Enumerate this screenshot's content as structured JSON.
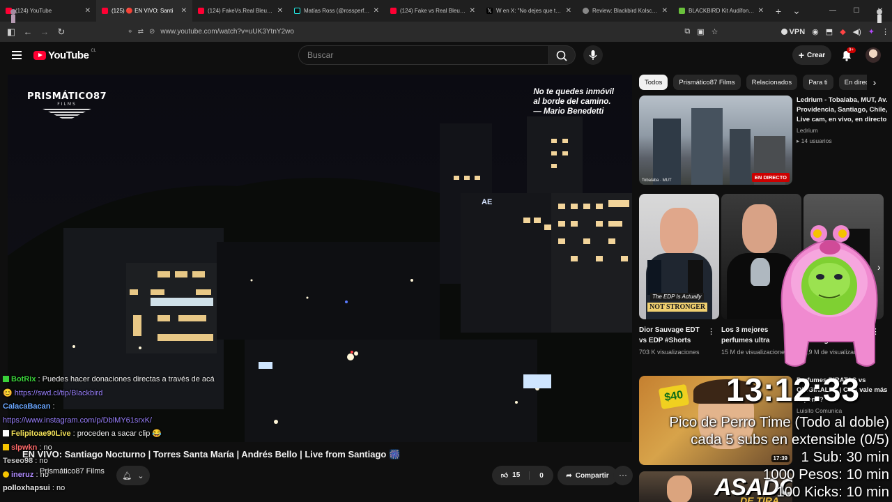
{
  "tabs": [
    {
      "title": "(124) YouTube",
      "favicon": "youtube-icon",
      "active": false
    },
    {
      "title": "(125) 🔴 EN VIVO: Santi",
      "favicon": "youtube-icon",
      "active": true
    },
    {
      "title": "(124) FakeVs.Real Bleu de Ch",
      "favicon": "youtube-icon",
      "active": false
    },
    {
      "title": "Matías Ross (@rossperfume",
      "favicon": "tiktok-icon",
      "active": false
    },
    {
      "title": "(124) Fake vs Real Bleu de Ch",
      "favicon": "youtube-icon",
      "active": false
    },
    {
      "title": "W en X: \"No dejes que te cu",
      "favicon": "x-icon",
      "active": false
    },
    {
      "title": "Review: Blackbird Kolsch | Bl",
      "favicon": "review-icon",
      "active": false
    },
    {
      "title": "BLACKBIRD Kit Audífonos Y",
      "favicon": "store-icon",
      "active": false
    }
  ],
  "address": {
    "url": "www.youtube.com/watch?v=uUK3YtnY2wo",
    "vpn_label": "VPN"
  },
  "youtube": {
    "logo_text": "YouTube",
    "country": "CL",
    "search_placeholder": "Buscar",
    "create_label": "Crear",
    "notif_badge": "9+"
  },
  "video": {
    "brand_line1": "PRISMÁTICO87",
    "brand_line2": "FILMS",
    "quote_lines": [
      "No te quedes inmóvil",
      "al borde del camino.",
      "— Mario Benedetti"
    ],
    "title": "EN VIVO: Santiago Nocturno | Torres Santa María | Andrés Bello | Live from Santiago 🎆",
    "channel": "Prismático87 Films",
    "likes": "15",
    "dislikes": "0",
    "share_label": "Compartir"
  },
  "chat": [
    {
      "name": "BotRix",
      "text": " : Puedes hacer donaciones directas a través de acá 😊",
      "link": "https://swd.cl/tip/Blackbird",
      "color": "n1"
    },
    {
      "name": "CalacaBacan",
      "text": " :",
      "link": "https://www.instagram.com/p/DblMY61srxK/",
      "color": "n2"
    },
    {
      "name": "Felipitoae90Live",
      "text": " : proceden a sacar clip 😂",
      "link": "",
      "color": "n3"
    },
    {
      "name": "slpwkn",
      "text": " : no",
      "link": "",
      "color": "n4"
    },
    {
      "name": "Teseo98",
      "text": " : no",
      "link": "",
      "color": "n5"
    },
    {
      "name": "ineruz",
      "text": " : no",
      "link": "",
      "color": "n6"
    },
    {
      "name": "polloxhapsui",
      "text": " : no",
      "link": "",
      "color": "n7"
    }
  ],
  "chips": [
    "Todos",
    "Prismático87 Films",
    "Relacionados",
    "Para ti",
    "En directo"
  ],
  "rec1": {
    "title": "Ledrium - Tobalaba, MUT, Av. Providencia, Santiago, Chile, Live cam, en vivo, en directo",
    "channel": "Ledrium",
    "meta": "14 usuarios",
    "live_label": "EN DIRECTO",
    "thumb_caption": "Tobalaba · MUT"
  },
  "shorts": [
    {
      "title": "Dior Sauvage EDT vs EDP #Shorts",
      "views": "703 K visualizaciones",
      "caption_top": "The EDP Is Actually",
      "caption_bottom": "NOT STRONGER"
    },
    {
      "title": "Los 3 mejores perfumes ultra",
      "views": "15 M de visualizaciones"
    },
    {
      "title": "Fake vs Real Dior Sauvage Perfume",
      "views": "5,9 M de visualizaciones"
    }
  ],
  "rec3": {
    "title": "Perfumes PIRATAS vs ORIGINALES | Cuál vale más la pena?",
    "channel": "Luisito Comunica",
    "meta": "",
    "duration": "17:39"
  },
  "rec4": {
    "big_text": "ASADO",
    "sub_text": "DE TIRA"
  },
  "overlay": {
    "clock": "13:12:33",
    "line1": "Pico de Perro Time (Todo al doble)",
    "line2": "cada 5 subs en extensible (0/5)",
    "line3": "1 Sub: 30 min",
    "line4": "1000 Pesos: 10 min",
    "line5": "100 Kicks: 10 min"
  }
}
